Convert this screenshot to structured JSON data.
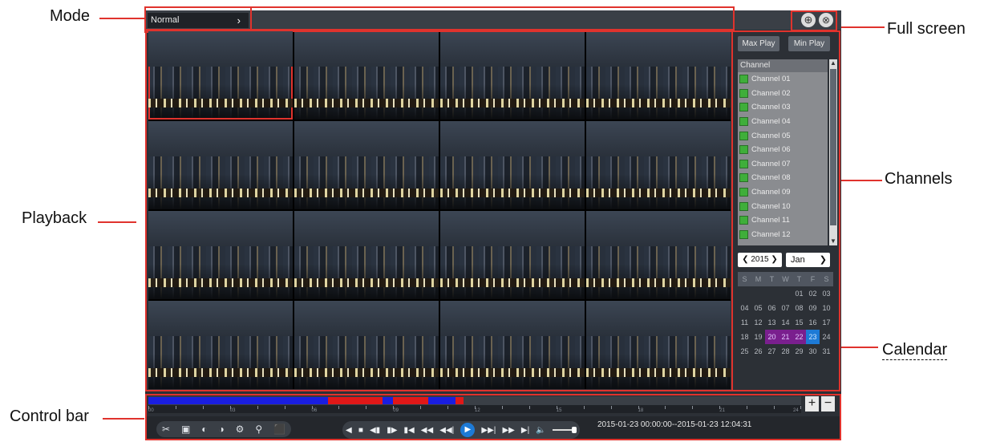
{
  "callouts": {
    "mode": "Mode",
    "full_screen": "Full screen",
    "channels": "Channels",
    "playback": "Playback",
    "calendar": "Calendar",
    "control_bar": "Control bar"
  },
  "topbar": {
    "mode_value": "Normal",
    "mode_chevron": "›",
    "fullscreen_glyph": "⊕",
    "close_glyph": "⊗"
  },
  "side": {
    "max_play": "Max Play",
    "min_play": "Min Play",
    "channel_header": "Channel",
    "channels": [
      "Channel 01",
      "Channel 02",
      "Channel 03",
      "Channel 04",
      "Channel 05",
      "Channel 06",
      "Channel 07",
      "Channel 08",
      "Channel 09",
      "Channel 10",
      "Channel 11",
      "Channel 12"
    ],
    "year": "2015",
    "month": "Jan",
    "weekdays": [
      "S",
      "M",
      "T",
      "W",
      "T",
      "F",
      "S"
    ],
    "weeks": [
      [
        "",
        "",
        "",
        "",
        "01",
        "02",
        "03"
      ],
      [
        "04",
        "05",
        "06",
        "07",
        "08",
        "09",
        "10"
      ],
      [
        "11",
        "12",
        "13",
        "14",
        "15",
        "16",
        "17"
      ],
      [
        "18",
        "19",
        "20",
        "21",
        "22",
        "23",
        "24"
      ],
      [
        "25",
        "26",
        "27",
        "28",
        "29",
        "30",
        "31"
      ]
    ],
    "recorded_days": [
      "20",
      "21",
      "22"
    ],
    "today": "23"
  },
  "timeline": {
    "tick_labels": [
      "00",
      "03",
      "06",
      "09",
      "12",
      "15",
      "18",
      "21",
      "24"
    ],
    "segments": [
      {
        "from": 0,
        "to": 6.6,
        "color": "#1a1ee0"
      },
      {
        "from": 6.6,
        "to": 8.6,
        "color": "#e01818"
      },
      {
        "from": 8.6,
        "to": 9.0,
        "color": "#1a1ee0"
      },
      {
        "from": 9.0,
        "to": 10.3,
        "color": "#e01818"
      },
      {
        "from": 10.3,
        "to": 11.3,
        "color": "#1a1ee0"
      },
      {
        "from": 11.3,
        "to": 11.6,
        "color": "#e01818"
      }
    ],
    "zoom_in": "+",
    "zoom_out": "−"
  },
  "control_bar": {
    "tools": [
      "✂",
      "▣",
      "◐",
      "◑",
      "⚙",
      "⚲",
      "⬛"
    ],
    "transport": [
      "◀",
      "■",
      "◀▮",
      "▮▶",
      "▮◀",
      "◀◀",
      "◀◀|",
      "▶▶|",
      "▶▶",
      "▶|",
      "🔈"
    ],
    "time_range": "2015-01-23 00:00:00--2015-01-23 12:04:31"
  },
  "colors": {
    "annotation": "#e0332d",
    "recorded": "#7a1f8e",
    "today": "#1d7ad6",
    "timeline_normal": "#1a1ee0",
    "timeline_alarm": "#e01818"
  }
}
